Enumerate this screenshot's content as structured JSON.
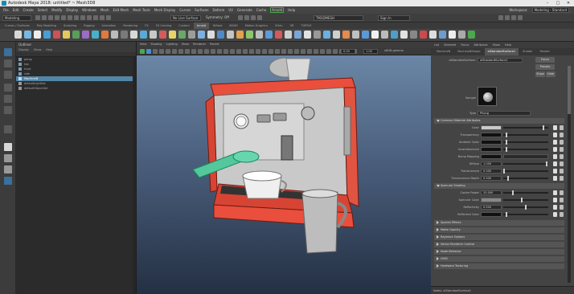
{
  "window": {
    "title": "Autodesk Maya 2018: untitled*   ~ Mesh3D8"
  },
  "menubar": {
    "items": [
      "File",
      "Edit",
      "Create",
      "Select",
      "Modify",
      "Display",
      "Windows",
      "Mesh",
      "Edit Mesh",
      "Mesh Tools",
      "Mesh Display",
      "Curves",
      "Surfaces",
      "Deform",
      "UV",
      "Generate",
      "Cache",
      "Arnold",
      "Help"
    ],
    "highlighted": "Arnold",
    "workspace_label": "Workspace:",
    "workspace_value": "Modeling - Standard"
  },
  "statusline": {
    "mode": "Modeling",
    "no_live": "No Live Surface",
    "symmetry": "Symmetry: Off",
    "field": "TM3DMESH",
    "signin": "Sign In"
  },
  "shelf": {
    "tabs": [
      "Curves / Surfaces",
      "Poly Modeling",
      "Sculpting",
      "Rigging",
      "Animation",
      "Rendering",
      "FX",
      "FX Caching",
      "Custom",
      "Arnold",
      "Bifrost",
      "MASH",
      "Motion Graphics",
      "XGen",
      "VR",
      "TURTLE"
    ],
    "active_tab": "Arnold"
  },
  "outliner": {
    "title": "Outliner",
    "menu": [
      "Display",
      "Show",
      "Help"
    ],
    "items": [
      {
        "label": "persp",
        "selected": false
      },
      {
        "label": "top",
        "selected": false
      },
      {
        "label": "front",
        "selected": false
      },
      {
        "label": "side",
        "selected": false
      },
      {
        "label": "MachineN",
        "selected": true
      },
      {
        "label": "defaultLightSet",
        "selected": false
      },
      {
        "label": "defaultObjectSet",
        "selected": false
      }
    ]
  },
  "viewport": {
    "menu": [
      "View",
      "Shading",
      "Lighting",
      "Show",
      "Renderer",
      "Panels"
    ],
    "value1": "0.00",
    "value2": "1.00",
    "color_space": "sRGB gamma"
  },
  "attribute_editor": {
    "menu": [
      "List",
      "Selected",
      "Focus",
      "Attributes",
      "Show",
      "Help"
    ],
    "tabs": [
      "MachineN",
      "MachineNShape",
      "aiStandardSurface1",
      "Shader",
      "Render"
    ],
    "active_tab": "aiStandardSurface1",
    "type_label": "aiStandardSurface:",
    "type_value": "aiStandardSurface1",
    "focus_btn": "Focus",
    "presets_btn": "Presets",
    "show_btn": "Show",
    "hide_btn": "Hide",
    "sample_label": "Sample",
    "type_row_label": "Type",
    "type_row_value": "Phong",
    "common_section": "Common Material Attributes",
    "rows": [
      {
        "label": "Color",
        "value": "",
        "knob": 0.9
      },
      {
        "label": "Transparency",
        "value": "",
        "knob": 0.05
      },
      {
        "label": "Ambient Color",
        "value": "",
        "knob": 0.05
      },
      {
        "label": "Incandescence",
        "value": "",
        "knob": 0.05
      },
      {
        "label": "Bump Mapping",
        "value": "",
        "knob": -1
      },
      {
        "label": "Diffuse",
        "value": "1.000",
        "knob": 0.98
      },
      {
        "label": "Translucence",
        "value": "0.000",
        "knob": 0.0
      },
      {
        "label": "Translucence Depth",
        "value": "0.500",
        "knob": 0.1
      },
      {
        "label": "Translucence Focus",
        "value": "0.500",
        "knob": 0.5
      }
    ],
    "specular_section": "Specular Shading",
    "spec_rows": [
      {
        "label": "Cosine Power",
        "value": "20.000",
        "knob": 0.2
      },
      {
        "label": "Specular Color",
        "value": "",
        "knob": 0.4
      },
      {
        "label": "Reflectivity",
        "value": "0.500",
        "knob": 0.5
      },
      {
        "label": "Reflected Color",
        "value": "",
        "knob": 0.05
      }
    ],
    "closed_sections": [
      "Special Effects",
      "Matte Opacity",
      "Raytrace Options",
      "Vector Renderer Control",
      "Node Behavior",
      "UUID",
      "Hardware Texturing"
    ],
    "notes_label": "Notes: aiStandardSurface1"
  }
}
